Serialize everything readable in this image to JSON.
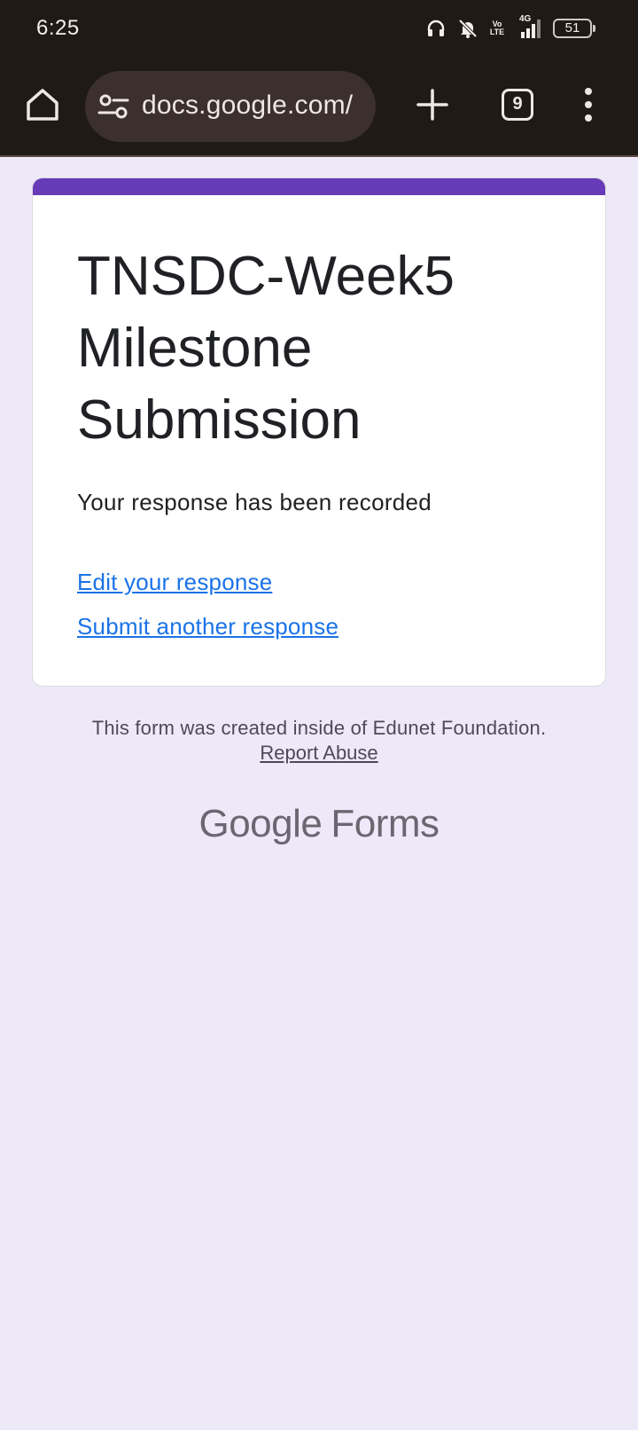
{
  "status_bar": {
    "time": "6:25",
    "network_label_top": "Vo",
    "network_label_bottom": "LTE",
    "network_type": "4G",
    "battery_level": "51"
  },
  "browser": {
    "url": "docs.google.com/",
    "tab_count": "9",
    "icons": [
      "home-icon",
      "site-settings-icon",
      "new-tab-icon",
      "tab-switcher-icon",
      "more-menu-icon"
    ]
  },
  "form": {
    "title": "TNSDC-Week5 Milestone Submission",
    "confirmation": "Your response has been recorded",
    "edit_link": "Edit your response",
    "submit_another_link": "Submit another response",
    "accent_color": "#673ab7"
  },
  "footer": {
    "note": "This form was created inside of Edunet Foundation.",
    "report_abuse": "Report Abuse",
    "logo_google": "Google",
    "logo_forms": "Forms"
  }
}
